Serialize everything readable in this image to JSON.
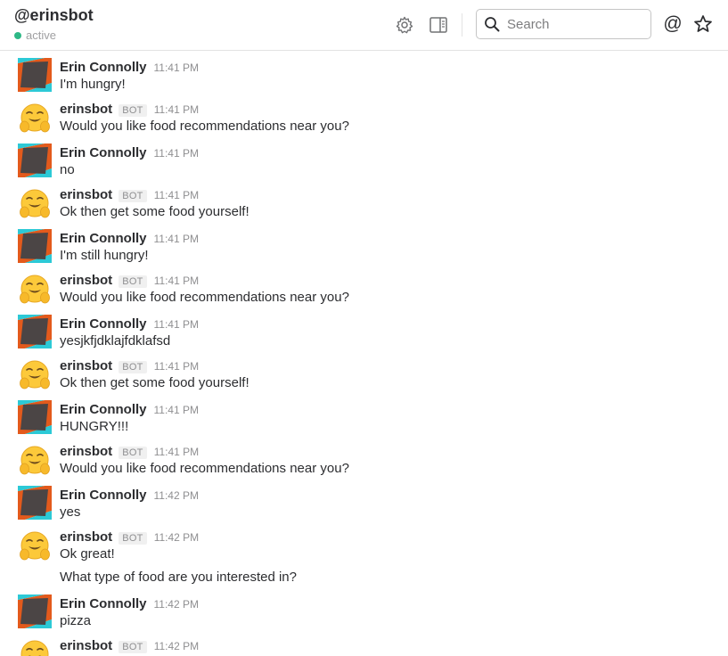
{
  "header": {
    "channel": "@erinsbot",
    "status": "active",
    "status_color": "#2eb886",
    "search_placeholder": "Search",
    "at_symbol": "@",
    "icons": [
      "gear-icon",
      "sidebar-toggle-icon",
      "search-icon",
      "mentions-icon",
      "star-icon"
    ]
  },
  "messages": [
    {
      "author": "Erin Connolly",
      "bot": false,
      "time": "11:41 PM",
      "text": "I'm hungry!"
    },
    {
      "author": "erinsbot",
      "bot": true,
      "badge": "BOT",
      "time": "11:41 PM",
      "text": "Would you like food recommendations near you?"
    },
    {
      "author": "Erin Connolly",
      "bot": false,
      "time": "11:41 PM",
      "text": "no"
    },
    {
      "author": "erinsbot",
      "bot": true,
      "badge": "BOT",
      "time": "11:41 PM",
      "text": "Ok then get some food yourself!"
    },
    {
      "author": "Erin Connolly",
      "bot": false,
      "time": "11:41 PM",
      "text": "I'm still hungry!"
    },
    {
      "author": "erinsbot",
      "bot": true,
      "badge": "BOT",
      "time": "11:41 PM",
      "text": "Would you like food recommendations near you?"
    },
    {
      "author": "Erin Connolly",
      "bot": false,
      "time": "11:41 PM",
      "text": "yesjkfjdklajfdklafsd"
    },
    {
      "author": "erinsbot",
      "bot": true,
      "badge": "BOT",
      "time": "11:41 PM",
      "text": "Ok then get some food yourself!"
    },
    {
      "author": "Erin Connolly",
      "bot": false,
      "time": "11:41 PM",
      "text": "HUNGRY!!!"
    },
    {
      "author": "erinsbot",
      "bot": true,
      "badge": "BOT",
      "time": "11:41 PM",
      "text": "Would you like food recommendations near you?"
    },
    {
      "author": "Erin Connolly",
      "bot": false,
      "time": "11:42 PM",
      "text": "yes"
    },
    {
      "author": "erinsbot",
      "bot": true,
      "badge": "BOT",
      "time": "11:42 PM",
      "text": "Ok great!",
      "text2": "What type of food are you interested in?"
    },
    {
      "author": "Erin Connolly",
      "bot": false,
      "time": "11:42 PM",
      "text": "pizza"
    },
    {
      "author": "erinsbot",
      "bot": true,
      "badge": "BOT",
      "time": "11:42 PM",
      "text": ""
    }
  ]
}
